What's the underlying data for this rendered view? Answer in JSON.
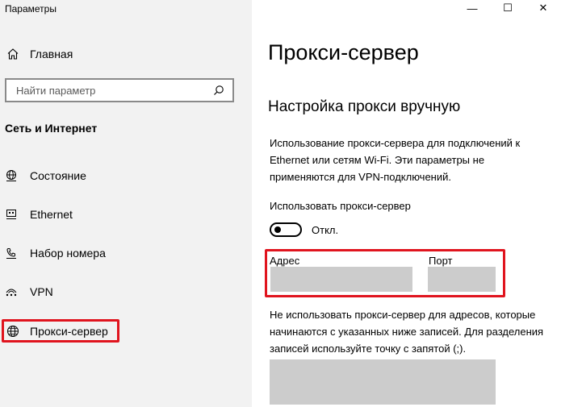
{
  "window": {
    "app_title": "Параметры",
    "controls": {
      "minimize": "—",
      "maximize": "☐",
      "close": "✕"
    }
  },
  "sidebar": {
    "home": {
      "label": "Главная",
      "icon": "home-icon"
    },
    "search": {
      "placeholder": "Найти параметр",
      "value": "",
      "icon": "search-icon"
    },
    "section_heading": "Сеть и Интернет",
    "items": [
      {
        "label": "Состояние",
        "icon": "globe-network-icon",
        "active": false
      },
      {
        "label": "Ethernet",
        "icon": "ethernet-icon",
        "active": false
      },
      {
        "label": "Набор номера",
        "icon": "dialup-icon",
        "active": false
      },
      {
        "label": "VPN",
        "icon": "vpn-icon",
        "active": false
      },
      {
        "label": "Прокси-сервер",
        "icon": "globe-icon",
        "active": true
      }
    ]
  },
  "main": {
    "page_title": "Прокси-сервер",
    "sub_title": "Настройка прокси вручную",
    "description": "Использование прокси-сервера для подключений к Ethernet или сетям Wi-Fi. Эти параметры не применяются для VPN-подключений.",
    "toggle_label": "Использовать прокси-сервер",
    "toggle_state": "Откл.",
    "toggle_on": false,
    "address_label": "Адрес",
    "address_value": "",
    "port_label": "Порт",
    "port_value": "",
    "exclude_description": "Не использовать прокси-сервер для адресов, которые начинаются с указанных ниже записей. Для разделения записей используйте точку с запятой (;).",
    "exclude_value": ""
  },
  "colors": {
    "highlight": "#e0141e",
    "sidebar_bg": "#f2f2f2",
    "input_bg": "#cccccc"
  }
}
